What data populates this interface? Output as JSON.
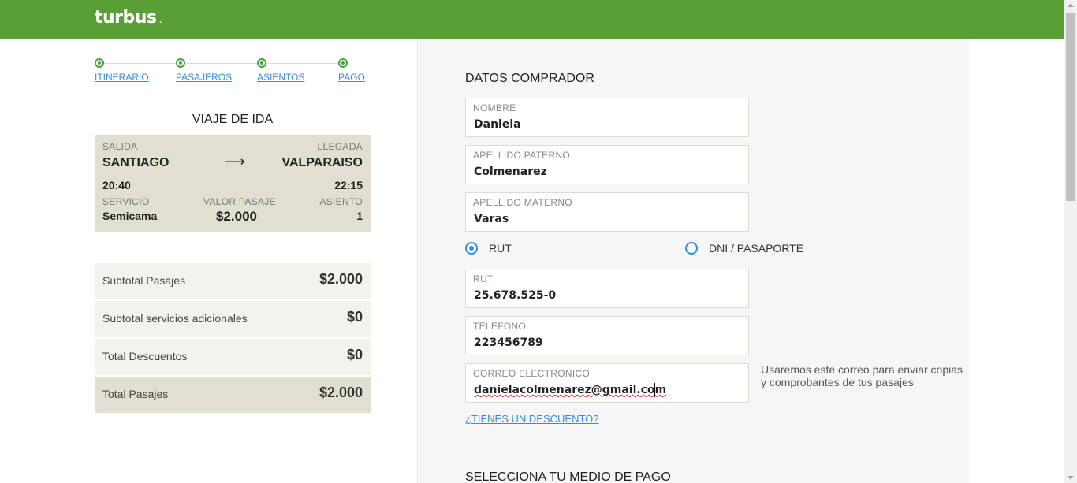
{
  "header": {
    "logo": "turbus",
    "logo_mark": "."
  },
  "steps": [
    {
      "label": "ITINERARIO"
    },
    {
      "label": "PASAJEROS"
    },
    {
      "label": "ASIENTOS"
    },
    {
      "label": "PAGO"
    }
  ],
  "trip": {
    "title": "VIAJE DE IDA",
    "departure_label": "SALIDA",
    "arrival_label": "LLEGADA",
    "origin": "SANTIAGO",
    "arrow": "⟶",
    "destination": "VALPARAISO",
    "departure_time": "20:40",
    "arrival_time": "22:15",
    "service_label": "SERVICIO",
    "service": "Semicama",
    "fare_label": "VALOR PASAJE",
    "fare": "$2.000",
    "seat_label": "ASIENTO",
    "seat": "1"
  },
  "summary": [
    {
      "label": "Subtotal Pasajes",
      "value": "$2.000"
    },
    {
      "label": "Subtotal servicios adicionales",
      "value": "$0"
    },
    {
      "label": "Total Descuentos",
      "value": "$0"
    },
    {
      "label": "Total Pasajes",
      "value": "$2.000"
    }
  ],
  "buyer": {
    "title": "DATOS COMPRADOR",
    "nombre_label": "NOMBRE",
    "nombre": "Daniela",
    "paterno_label": "APELLIDO PATERNO",
    "paterno": "Colmenarez",
    "materno_label": "APELLIDO MATERNO",
    "materno": "Varas",
    "doc_option_rut": "RUT",
    "doc_option_dni": "DNI / PASAPORTE",
    "doc_selected": "RUT",
    "rut_label": "RUT",
    "rut": "25.678.525-0",
    "telefono_label": "TELEFONO",
    "telefono": "223456789",
    "correo_label": "CORREO ELECTRONICO",
    "correo": "danielacolmenarez@gmail.com",
    "correo_help": "Usaremos este correo para enviar copias y comprobantes de tus pasajes",
    "discount_link": "¿TIENES UN DESCUENTO?"
  },
  "payment": {
    "title": "SELECCIONA TU MEDIO DE PAGO"
  },
  "colors": {
    "brand_green": "#5a9e36",
    "step_green": "#48a23f",
    "link_blue": "#3a8bd6",
    "radio_blue": "#2f8fe0",
    "trip_bg": "#e1dfcf"
  }
}
